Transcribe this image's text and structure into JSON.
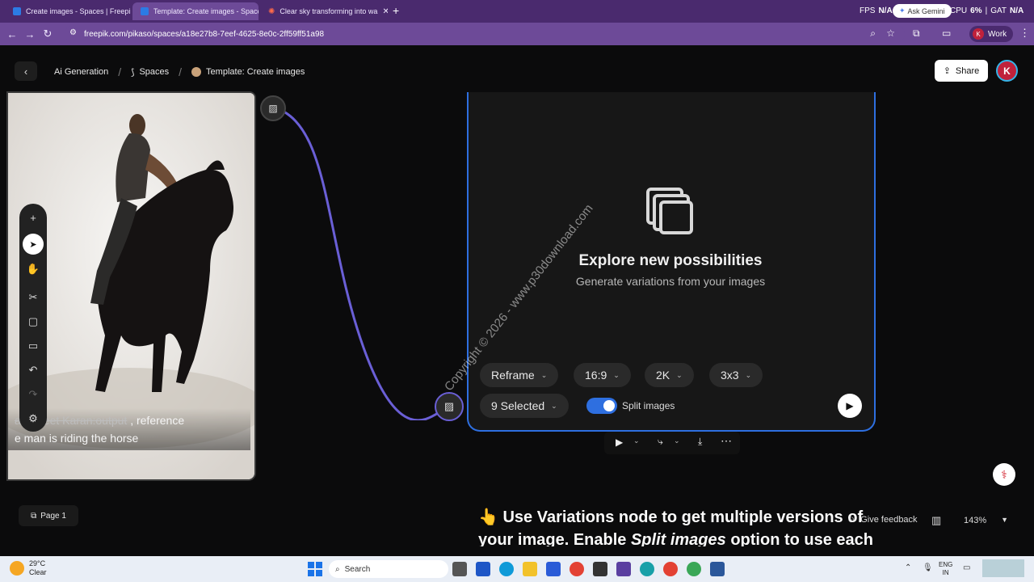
{
  "browser": {
    "tabs": [
      {
        "label": "Create images - Spaces | Freepik"
      },
      {
        "label": "Template: Create images - Spaces"
      },
      {
        "label": "Clear sky transforming into wa"
      }
    ],
    "new_tab": "+",
    "sys_top_left": "FPS",
    "sys_top_na": "N/A",
    "ask_gemini": "Ask Gemini",
    "sys_cpu": "CPU",
    "sys_cpu_val": "6%",
    "sys_gat": "GAT",
    "sys_gat_val": "N/A",
    "url": "freepik.com/pikaso/spaces/a18e27b8-7eef-4625-8e0c-2ff59ff51a98",
    "profile_label": "Work",
    "profile_initial": "K"
  },
  "header": {
    "crumb_ai": "Ai Generation",
    "crumb_spaces": "Spaces",
    "crumb_template": "Template: Create images",
    "share_label": "Share",
    "avatar_initial": "K"
  },
  "image_node": {
    "prompt_line1_faded": "ar -sheet Karan:output",
    "prompt_line1": ", reference",
    "prompt_line2": "e man is riding the horse"
  },
  "variations_node": {
    "title": "Explore new possibilities",
    "subtitle": "Generate variations from your images",
    "options": {
      "mode": "Reframe",
      "ratio": "16:9",
      "resolution": "2K",
      "grid": "3x3",
      "selected": "9 Selected",
      "split_label": "Split images"
    },
    "split_enabled": true
  },
  "watermark": "Copyright © 2026 - www.p30download.com",
  "footer": {
    "page_label": "Page 1",
    "feedback": "Give feedback",
    "zoom": "143%"
  },
  "note": {
    "emoji": "👆",
    "line1": "Use Variations node to get multiple versions of",
    "line2_a": "your image. Enable ",
    "line2_em": "Split images",
    "line2_b": " option to use each"
  },
  "taskbar": {
    "weather_temp": "29°C",
    "weather_desc": "Clear",
    "search": "Search",
    "lang1": "ENG",
    "lang2": "IN"
  },
  "colors": {
    "accent": "#2e6fe0",
    "tab_bar": "#4a2a6e",
    "url_bar": "#6d4a98",
    "wire": "#6a5fd6"
  }
}
